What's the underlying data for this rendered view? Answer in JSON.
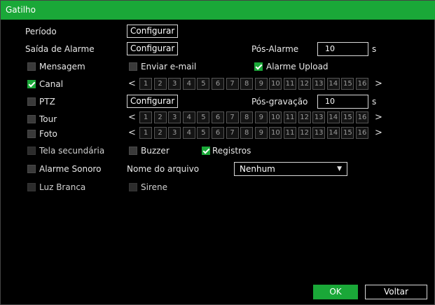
{
  "title": "Gatilho",
  "rows": {
    "periodo": {
      "label": "Período",
      "button": "Configurar"
    },
    "saida": {
      "label": "Saída de Alarme",
      "button": "Configurar",
      "pos_label": "Pós-Alarme",
      "pos_value": "10",
      "unit": "s"
    },
    "mensagem": {
      "label": "Mensagem",
      "checked": false
    },
    "email": {
      "label": "Enviar e-mail",
      "checked": false
    },
    "upload": {
      "label": "Alarme Upload",
      "checked": true
    },
    "canal": {
      "label": "Canal",
      "checked": true
    },
    "ptz": {
      "label": "PTZ",
      "checked": false,
      "button": "Configurar",
      "pos_label": "Pós-gravação",
      "pos_value": "10",
      "unit": "s"
    },
    "tour": {
      "label": "Tour",
      "checked": false
    },
    "foto": {
      "label": "Foto",
      "checked": false
    },
    "tela": {
      "label": "Tela secundária",
      "checked": false
    },
    "buzzer": {
      "label": "Buzzer",
      "checked": false
    },
    "registros": {
      "label": "Registros",
      "checked": true
    },
    "sonoro": {
      "label": "Alarme Sonoro",
      "checked": false
    },
    "arquivo": {
      "label": "Nome do arquivo",
      "value": "Nenhum"
    },
    "luz": {
      "label": "Luz Branca",
      "checked": false
    },
    "sirene": {
      "label": "Sirene",
      "checked": false
    }
  },
  "channels": [
    "1",
    "2",
    "3",
    "4",
    "5",
    "6",
    "7",
    "8",
    "9",
    "10",
    "11",
    "12",
    "13",
    "14",
    "15",
    "16"
  ],
  "arrows": {
    "left": "<",
    "right": ">"
  },
  "footer": {
    "ok": "OK",
    "back": "Voltar"
  },
  "colors": {
    "accent": "#1aa838",
    "background": "#000000"
  }
}
